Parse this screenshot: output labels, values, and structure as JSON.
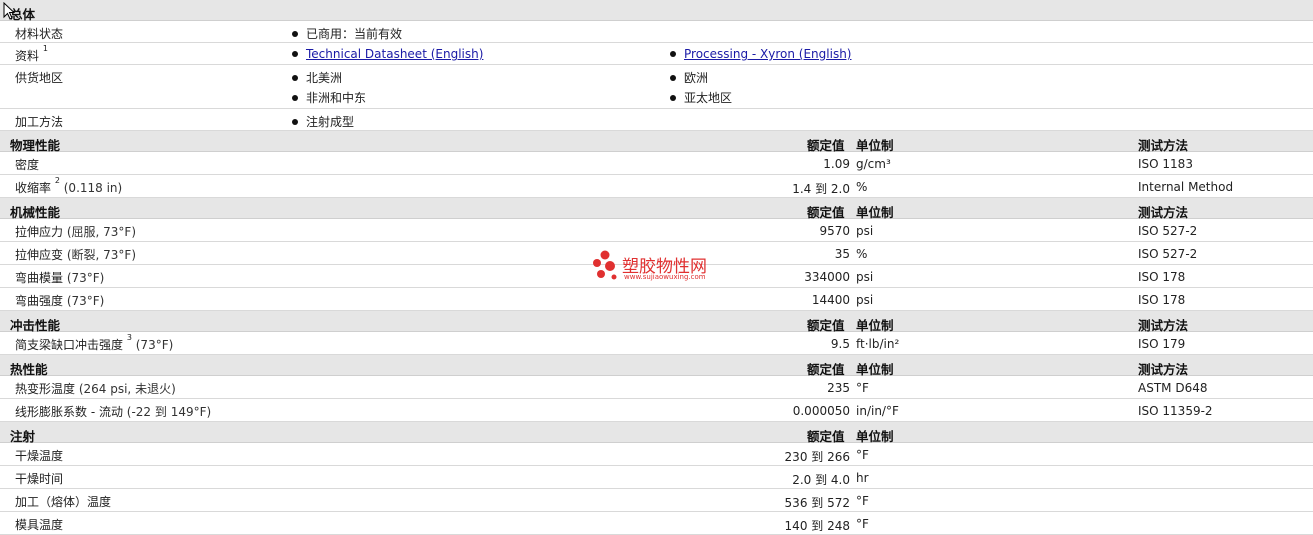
{
  "general": {
    "title": "总体",
    "status": {
      "label": "材料状态",
      "value": "已商用：当前有效"
    },
    "docs": {
      "label": "资料",
      "sup": "1",
      "link1": "Technical Datasheet (English)",
      "link2": "Processing - Xyron (English)"
    },
    "regions": {
      "label": "供货地区",
      "items": [
        "北美洲",
        "欧洲",
        "非洲和中东",
        "亚太地区"
      ]
    },
    "processing": {
      "label": "加工方法",
      "value": "注射成型"
    }
  },
  "headers": {
    "rated": "额定值",
    "unit": "单位制",
    "test": "测试方法"
  },
  "sections": [
    {
      "title": "物理性能",
      "has_test": true,
      "rows": [
        {
          "label": "密度",
          "sup": "",
          "cond": "",
          "value": "1.09",
          "unit": "g/cm³",
          "test": "ISO 1183"
        },
        {
          "label": "收缩率",
          "sup": "2",
          "cond": " (0.118 in)",
          "value": "1.4 到  2.0",
          "unit": "%",
          "test": "Internal Method"
        }
      ]
    },
    {
      "title": "机械性能",
      "has_test": true,
      "rows": [
        {
          "label": "拉伸应力",
          "sup": "",
          "cond": " (屈服, 73°F)",
          "value": "9570",
          "unit": "psi",
          "test": "ISO 527-2"
        },
        {
          "label": "拉伸应变",
          "sup": "",
          "cond": " (断裂, 73°F)",
          "value": "35",
          "unit": "%",
          "test": "ISO 527-2"
        },
        {
          "label": "弯曲模量",
          "sup": "",
          "cond": " (73°F)",
          "value": "334000",
          "unit": "psi",
          "test": "ISO 178"
        },
        {
          "label": "弯曲强度",
          "sup": "",
          "cond": " (73°F)",
          "value": "14400",
          "unit": "psi",
          "test": "ISO 178"
        }
      ]
    },
    {
      "title": "冲击性能",
      "has_test": true,
      "rows": [
        {
          "label": "简支梁缺口冲击强度",
          "sup": "3",
          "cond": " (73°F)",
          "value": "9.5",
          "unit": "ft·lb/in²",
          "test": "ISO 179"
        }
      ]
    },
    {
      "title": "热性能",
      "has_test": true,
      "rows": [
        {
          "label": "热变形温度",
          "sup": "",
          "cond": " (264 psi, 未退火)",
          "value": "235",
          "unit": "°F",
          "test": "ASTM D648"
        },
        {
          "label": "线形膨胀系数 - 流动",
          "sup": "",
          "cond": " (-22 到  149°F)",
          "value": "0.000050",
          "unit": "in/in/°F",
          "test": "ISO 11359-2"
        }
      ]
    },
    {
      "title": "注射",
      "has_test": false,
      "rows": [
        {
          "label": "干燥温度",
          "sup": "",
          "cond": "",
          "value": "230 到  266",
          "unit": "°F",
          "test": ""
        },
        {
          "label": "干燥时间",
          "sup": "",
          "cond": "",
          "value": "2.0 到  4.0",
          "unit": "hr",
          "test": ""
        },
        {
          "label": "加工（熔体）温度",
          "sup": "",
          "cond": "",
          "value": "536 到  572",
          "unit": "°F",
          "test": ""
        },
        {
          "label": "模具温度",
          "sup": "",
          "cond": "",
          "value": "140 到  248",
          "unit": "°F",
          "test": ""
        }
      ]
    }
  ],
  "watermark": {
    "text": "塑胶物性网",
    "sub": "www.sujiaowuxing.com",
    "color": "#e03030"
  }
}
